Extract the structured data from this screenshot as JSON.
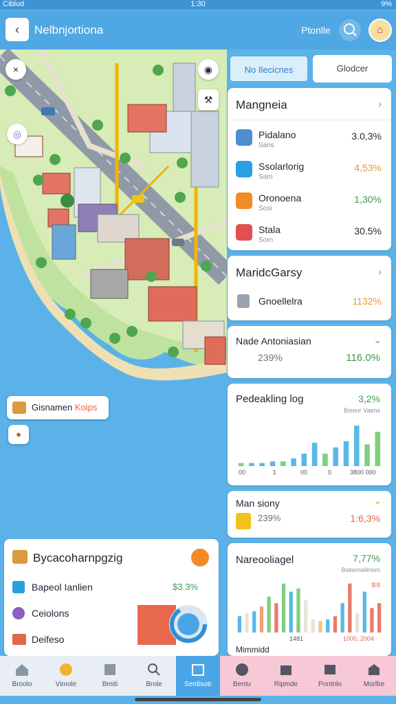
{
  "status_bar": {
    "carrier": "Ciblud",
    "time": "1:30",
    "battery": "9%"
  },
  "header": {
    "title": "Nelbnjortiona",
    "link": "Ptonlle"
  },
  "map": {
    "tooltip": {
      "label": "Gisnamen",
      "accent": "Koips"
    }
  },
  "tabs": [
    {
      "label": "No Ilecicnes"
    },
    {
      "label": "Glodcer"
    }
  ],
  "card1": {
    "title": "Mangneia",
    "items": [
      {
        "title": "Pidalano",
        "sub": "Sans",
        "value": "3.0,3%",
        "color": "#1f2430",
        "icon_color": "#4d8fd0"
      },
      {
        "title": "Ssolarlorig",
        "sub": "Sam",
        "value": "4,53%",
        "color": "#e59a2f",
        "icon_color": "#29a0e0"
      },
      {
        "title": "Oronoena",
        "sub": "Sosi",
        "value": "1,30%",
        "color": "#3f9a4c",
        "icon_color": "#f28a26"
      },
      {
        "title": "Stala",
        "sub": "Sorn",
        "value": "30.5%",
        "color": "#1f2430",
        "icon_color": "#e05050"
      }
    ]
  },
  "card2": {
    "title": "MaridcGarsy",
    "item": {
      "title": "Gnoellelra",
      "value": "1132%",
      "color": "#e59a2f"
    }
  },
  "card3": {
    "title": "Nade Antoniasian",
    "left_value": "239%",
    "right_value": "116.0%",
    "right_color": "#3f9a4c"
  },
  "card4": {
    "title": "Pedeakling log",
    "value": "3,2%",
    "subtitle": "Biseur Vaens",
    "x_labels": [
      "00",
      "1",
      "00",
      "0",
      "3800 000"
    ]
  },
  "card5": {
    "title": "Man siony",
    "left_value": "239%",
    "right_value": "1:6,3%",
    "right_color": "#e0674a"
  },
  "card6": {
    "title": "Nareooliagel",
    "value": "7,77%",
    "subtitle": "Bseemeilinom",
    "legend_value": "$!8",
    "x_labels": [
      "1481",
      "1000, 2004"
    ],
    "footer_text": "Mimmidd"
  },
  "left_card": {
    "title": "Bycacoharnpgzig",
    "items": [
      {
        "label": "Bapeol Ianlien",
        "value": "$3.3%"
      },
      {
        "label": "Ceiolons"
      },
      {
        "label": "Deifeso"
      }
    ]
  },
  "bottom_nav": [
    {
      "label": "Broolo"
    },
    {
      "label": "Vimole"
    },
    {
      "label": "Bmiti"
    },
    {
      "label": "Brole"
    },
    {
      "label": "Serdisotr"
    },
    {
      "label": "Bentu"
    },
    {
      "label": "Ripmde"
    },
    {
      "label": "Pontnlo"
    },
    {
      "label": "Morlbe"
    }
  ],
  "chart_data": [
    {
      "type": "bar",
      "title": "Pedeakling log",
      "categories": [
        "1",
        "2",
        "3",
        "4",
        "5",
        "6",
        "7",
        "8",
        "9",
        "10",
        "11",
        "12",
        "13",
        "14"
      ],
      "series": [
        {
          "values": [
            2,
            2,
            2,
            3,
            3,
            5,
            8,
            15,
            8,
            12,
            16,
            26,
            14,
            22
          ]
        }
      ],
      "colors": [
        "#7fcf7f",
        "#58b9e6",
        "#58b9e6",
        "#58b9e6",
        "#7fcf7f",
        "#58b9e6",
        "#58b9e6",
        "#58b9e6",
        "#7fcf7f",
        "#58b9e6",
        "#58b9e6",
        "#58b9e6",
        "#7fcf7f",
        "#7fcf7f"
      ],
      "ylim": [
        0,
        30
      ],
      "grid": false
    },
    {
      "type": "bar",
      "title": "Nareooliagel",
      "categories": [
        "1",
        "2",
        "3",
        "4",
        "5",
        "6",
        "7",
        "8",
        "9",
        "10",
        "11",
        "12",
        "13",
        "14",
        "15",
        "16",
        "17",
        "18",
        "19",
        "20"
      ],
      "series": [
        {
          "values": [
            10,
            12,
            13,
            16,
            22,
            18,
            30,
            25,
            27,
            20,
            8,
            7,
            8,
            10,
            18,
            30,
            12,
            25,
            15,
            18
          ]
        }
      ],
      "colors": [
        "#58b9e6",
        "#e8e4d6",
        "#58b9e6",
        "#f2a27a",
        "#7fcf7f",
        "#e87a6a",
        "#7fcf7f",
        "#58b9e6",
        "#7fcf7f",
        "#e8e4d6",
        "#e8e4d6",
        "#f2c77a",
        "#58b9e6",
        "#e87a6a",
        "#58b9e6",
        "#e87a6a",
        "#e8e4d6",
        "#58b9e6",
        "#e87a6a",
        "#e87a6a"
      ],
      "ylim": [
        0,
        32
      ],
      "grid": false
    }
  ]
}
